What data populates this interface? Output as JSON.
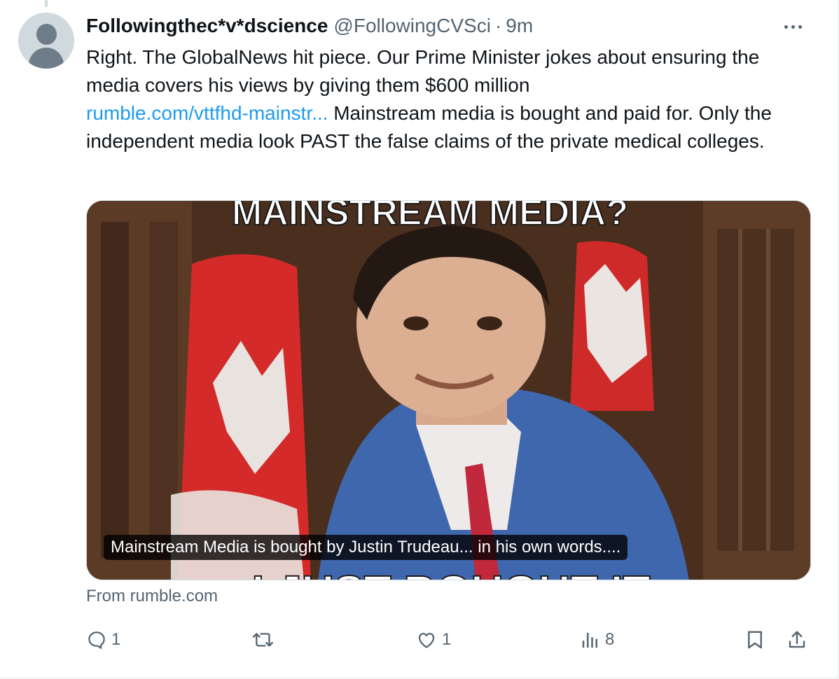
{
  "tweet": {
    "display_name": "Followingthec*v*dscience",
    "handle": "@FollowingCVSci",
    "separator": "·",
    "time": "9m",
    "text_part1": "Right. The GlobalNews hit piece. Our Prime Minister jokes about ensuring the media covers his views by giving them $600 million",
    "link_text": "rumble.com/vttfhd-mainstr...",
    "text_part2": " Mainstream media is bought and paid for. Only the independent media look PAST the false claims of the private medical colleges.",
    "media": {
      "top_text": "MAINSTREAM MEDIA?",
      "bottom_text": "I JUST BOUGHT IT",
      "caption": "Mainstream Media is bought by Justin Trudeau... in his own words...."
    },
    "source": "From rumble.com"
  },
  "actions": {
    "reply_icon": "reply-icon",
    "reply_count": "1",
    "retweet_icon": "retweet-icon",
    "like_icon": "heart-icon",
    "like_count": "1",
    "views_icon": "views-icon",
    "views_count": "8",
    "bookmark_icon": "bookmark-icon",
    "share_icon": "share-icon"
  },
  "colors": {
    "text": "#0f1419",
    "secondary": "#536471",
    "link": "#1d9bf0",
    "border": "#cfd9de"
  }
}
